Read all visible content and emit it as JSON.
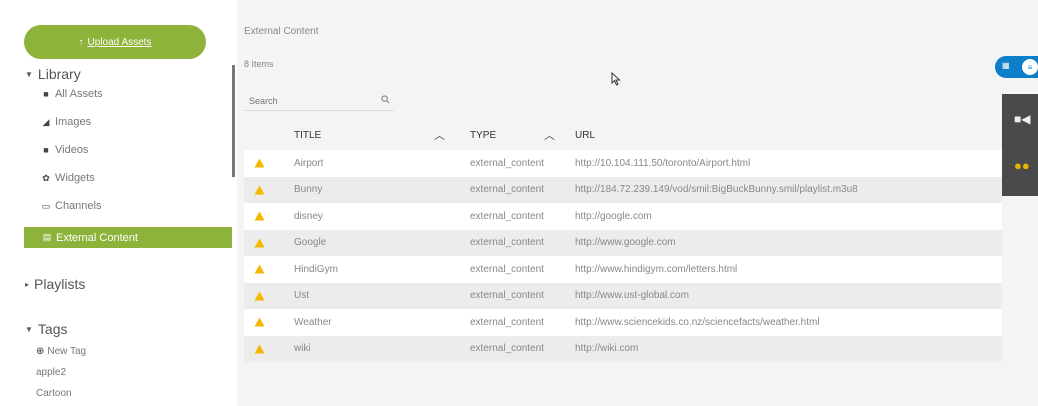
{
  "sidebar": {
    "upload_label": "Upload Assets",
    "library_title": "Library",
    "library_items": [
      {
        "label": "All Assets",
        "icon": "file-icon"
      },
      {
        "label": "Images",
        "icon": "image-icon"
      },
      {
        "label": "Videos",
        "icon": "video-icon"
      },
      {
        "label": "Widgets",
        "icon": "gear-icon"
      },
      {
        "label": "Channels",
        "icon": "monitor-icon"
      },
      {
        "label": "External Content",
        "icon": "external-content-icon",
        "active": true
      }
    ],
    "playlists_title": "Playlists",
    "tags_title": "Tags",
    "tags": [
      {
        "label": "New Tag",
        "icon": "plus-circle-icon"
      },
      {
        "label": "apple2"
      },
      {
        "label": "Cartoon"
      }
    ]
  },
  "main": {
    "breadcrumb": "External Content",
    "item_count": "8 Items",
    "search_placeholder": "Search",
    "columns": [
      "TITLE",
      "TYPE",
      "URL"
    ],
    "rows": [
      {
        "title": "Airport",
        "type": "external_content",
        "url": "http://10.104.111.50/toronto/Airport.html"
      },
      {
        "title": "Bunny",
        "type": "external_content",
        "url": "http://184.72.239.149/vod/smil:BigBuckBunny.smil/playlist.m3u8"
      },
      {
        "title": "disney",
        "type": "external_content",
        "url": "http://google.com"
      },
      {
        "title": "Google",
        "type": "external_content",
        "url": "http://www.google.com"
      },
      {
        "title": "HindiGym",
        "type": "external_content",
        "url": "http://www.hindigym.com/letters.html"
      },
      {
        "title": "Ust",
        "type": "external_content",
        "url": "http://www.ust-global.com"
      },
      {
        "title": "Weather",
        "type": "external_content",
        "url": "http://www.sciencekids.co.nz/sciencefacts/weather.html"
      },
      {
        "title": "wiki",
        "type": "external_content",
        "url": "http://wiki.com"
      }
    ]
  },
  "colors": {
    "accent_green": "#8db33a",
    "toggle_blue": "#0d7fc9",
    "warning_yellow": "#f5b800"
  }
}
